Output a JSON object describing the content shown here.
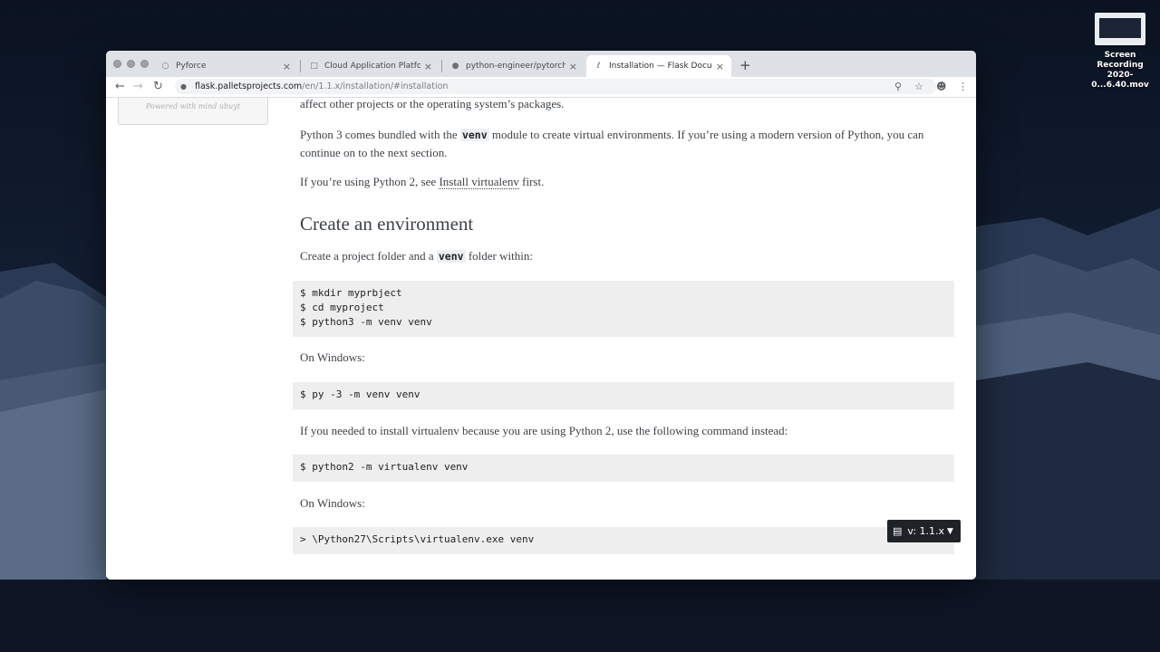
{
  "desktop": {
    "icon_label_line1": "Screen Recording",
    "icon_label_line2": "2020-0...6.40.mov"
  },
  "browser": {
    "tabs": [
      {
        "title": "Pyforce",
        "icon": "globe-icon",
        "active": false
      },
      {
        "title": "Cloud Application Platform | H",
        "icon": "document-icon",
        "active": false
      },
      {
        "title": "python-engineer/pytorchTutori",
        "icon": "github-icon",
        "active": false
      },
      {
        "title": "Installation — Flask Document",
        "icon": "flask-icon",
        "active": true
      }
    ],
    "new_tab": "+",
    "url_host": "flask.palletsprojects.com",
    "url_path": "/en/1.1.x/installation/#installation"
  },
  "page": {
    "sidebar_note": "Powered with mind ubuyt",
    "intro_tail": "affect other projects or the operating system’s packages.",
    "p1": {
      "before": "Python 3 comes bundled with the ",
      "code": "venv",
      "after": " module to create virtual environments. If you’re using a modern version of Python, you can continue on to the next section."
    },
    "p2": {
      "before": "If you’re using Python 2, see ",
      "link": "Install virtualenv",
      "after": " first."
    },
    "heading": "Create an environment",
    "p3": {
      "before": "Create a project folder and a ",
      "code": "venv",
      "after": " folder within:"
    },
    "code1": [
      "$ mkdir myprbject",
      "$ cd myproject",
      "$ python3 -m venv venv"
    ],
    "on_windows_1": "On Windows:",
    "code2": [
      "$ py -3 -m venv venv"
    ],
    "p4": "If you needed to install virtualenv because you are using Python 2, use the following command instead:",
    "code3": [
      "$ python2 -m virtualenv venv"
    ],
    "on_windows_2": "On Windows:",
    "code4": [
      "> \\Python27\\Scripts\\virtualenv.exe venv"
    ],
    "version_badge": "v: 1.1.x"
  }
}
